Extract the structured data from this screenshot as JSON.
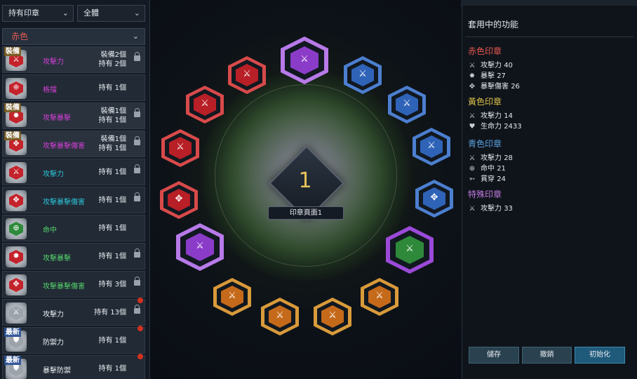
{
  "filters": {
    "own_filter": "持有印章",
    "type_filter": "全體"
  },
  "category": "赤色",
  "seals": [
    {
      "badge": "裝備",
      "name": "攻擊力",
      "color": "pink",
      "counts": [
        "裝備2個",
        "持有 2個"
      ],
      "locked": true,
      "icon": "crossed-swords-icon",
      "hex": "red"
    },
    {
      "badge": "",
      "name": "格擋",
      "color": "pink",
      "counts": [
        "持有 1個"
      ],
      "locked": false,
      "icon": "parry-icon",
      "hex": "red"
    },
    {
      "badge": "裝備",
      "name": "攻擊暴擊",
      "color": "pink",
      "counts": [
        "裝備1個",
        "持有 1個"
      ],
      "locked": true,
      "icon": "critical-icon",
      "hex": "red"
    },
    {
      "badge": "裝備",
      "name": "攻擊暴擊傷害",
      "color": "pink",
      "counts": [
        "裝備1個",
        "持有 1個"
      ],
      "locked": true,
      "icon": "critical-damage-icon",
      "hex": "red"
    },
    {
      "badge": "",
      "name": "攻擊力",
      "color": "cyan",
      "counts": [
        "持有 1個"
      ],
      "locked": true,
      "icon": "crossed-swords-icon",
      "hex": "red"
    },
    {
      "badge": "",
      "name": "攻擊暴擊傷害",
      "color": "cyan",
      "counts": [
        "持有 1個"
      ],
      "locked": true,
      "icon": "critical-damage-icon",
      "hex": "red"
    },
    {
      "badge": "",
      "name": "命中",
      "color": "green",
      "counts": [
        "持有 1個"
      ],
      "locked": false,
      "icon": "target-icon",
      "hex": "green"
    },
    {
      "badge": "",
      "name": "攻擊暴擊",
      "color": "green",
      "counts": [
        "持有 1個"
      ],
      "locked": true,
      "icon": "critical-icon",
      "hex": "red"
    },
    {
      "badge": "",
      "name": "攻擊暴擊傷害",
      "color": "green",
      "counts": [
        "持有 3個"
      ],
      "locked": true,
      "icon": "critical-damage-icon",
      "hex": "red"
    },
    {
      "badge": "",
      "name": "攻擊力",
      "color": "white",
      "counts": [
        "持有 13個"
      ],
      "locked": true,
      "icon": "crossed-swords-icon",
      "hex": "grey",
      "dot": true
    },
    {
      "badge": "最新",
      "name": "防禦力",
      "color": "white",
      "counts": [
        "持有 1個"
      ],
      "locked": false,
      "icon": "shield-icon",
      "hex": "grey",
      "dot": true
    },
    {
      "badge": "最新",
      "name": "暴擊防禦",
      "color": "white",
      "counts": [
        "持有 1個"
      ],
      "locked": false,
      "icon": "shield-icon",
      "hex": "grey",
      "dot": true
    }
  ],
  "page": {
    "number": "1",
    "label": "印章頁面1"
  },
  "slots": [
    {
      "color": "#8a3cc8",
      "ring": "#b77ae8",
      "icon": "crossed-swords-icon",
      "big": true
    },
    {
      "color": "#2f63b8",
      "ring": "#4c7fd0",
      "icon": "crossed-swords-icon"
    },
    {
      "color": "#2f63b8",
      "ring": "#4c7fd0",
      "icon": "crossed-swords-icon"
    },
    {
      "color": "#2f63b8",
      "ring": "#4c7fd0",
      "icon": "crossed-swords-icon"
    },
    {
      "color": "#2f63b8",
      "ring": "#4c7fd0",
      "icon": "critical-damage-icon"
    },
    {
      "color": "#2e8a3a",
      "ring": "#9b4ad8",
      "icon": "crossed-swords-icon",
      "big": true
    },
    {
      "color": "#c56a1a",
      "ring": "#d99a3a",
      "icon": "crossed-swords-icon"
    },
    {
      "color": "#c56a1a",
      "ring": "#d99a3a",
      "icon": "crossed-swords-icon"
    },
    {
      "color": "#c56a1a",
      "ring": "#d99a3a",
      "icon": "crossed-swords-icon"
    },
    {
      "color": "#c56a1a",
      "ring": "#d99a3a",
      "icon": "crossed-swords-icon"
    },
    {
      "color": "#8a3cc8",
      "ring": "#b77ae8",
      "icon": "crossed-swords-icon",
      "big": true
    },
    {
      "color": "#b81f26",
      "ring": "#d84a4a",
      "icon": "critical-damage-icon"
    },
    {
      "color": "#b81f26",
      "ring": "#d84a4a",
      "icon": "crossed-swords-icon"
    },
    {
      "color": "#b81f26",
      "ring": "#d84a4a",
      "icon": "crossed-swords-icon"
    },
    {
      "color": "#b81f26",
      "ring": "#d84a4a",
      "icon": "crossed-swords-icon"
    }
  ],
  "applied": {
    "title": "套用中的功能",
    "groups": [
      {
        "name": "赤色印章",
        "color": "#e8594f",
        "stats": [
          {
            "icon": "crossed-swords-icon",
            "label": "攻擊力",
            "value": "40"
          },
          {
            "icon": "critical-icon",
            "label": "暴擊",
            "value": "27"
          },
          {
            "icon": "critical-damage-icon",
            "label": "暴擊傷害",
            "value": "26"
          }
        ]
      },
      {
        "name": "黃色印章",
        "color": "#e2c34a",
        "stats": [
          {
            "icon": "crossed-swords-icon",
            "label": "攻擊力",
            "value": "14"
          },
          {
            "icon": "heart-icon",
            "label": "生命力",
            "value": "2433"
          }
        ]
      },
      {
        "name": "青色印章",
        "color": "#5aa2e0",
        "stats": [
          {
            "icon": "crossed-swords-icon",
            "label": "攻擊力",
            "value": "28"
          },
          {
            "icon": "target-icon",
            "label": "命中",
            "value": "21"
          },
          {
            "icon": "pierce-icon",
            "label": "貫穿",
            "value": "24"
          }
        ]
      },
      {
        "name": "特殊印章",
        "color": "#c27be0",
        "stats": [
          {
            "icon": "crossed-swords-icon",
            "label": "攻擊力",
            "value": "33"
          }
        ]
      }
    ]
  },
  "buttons": {
    "save": "儲存",
    "cancel": "撤銷",
    "reset": "初始化"
  }
}
